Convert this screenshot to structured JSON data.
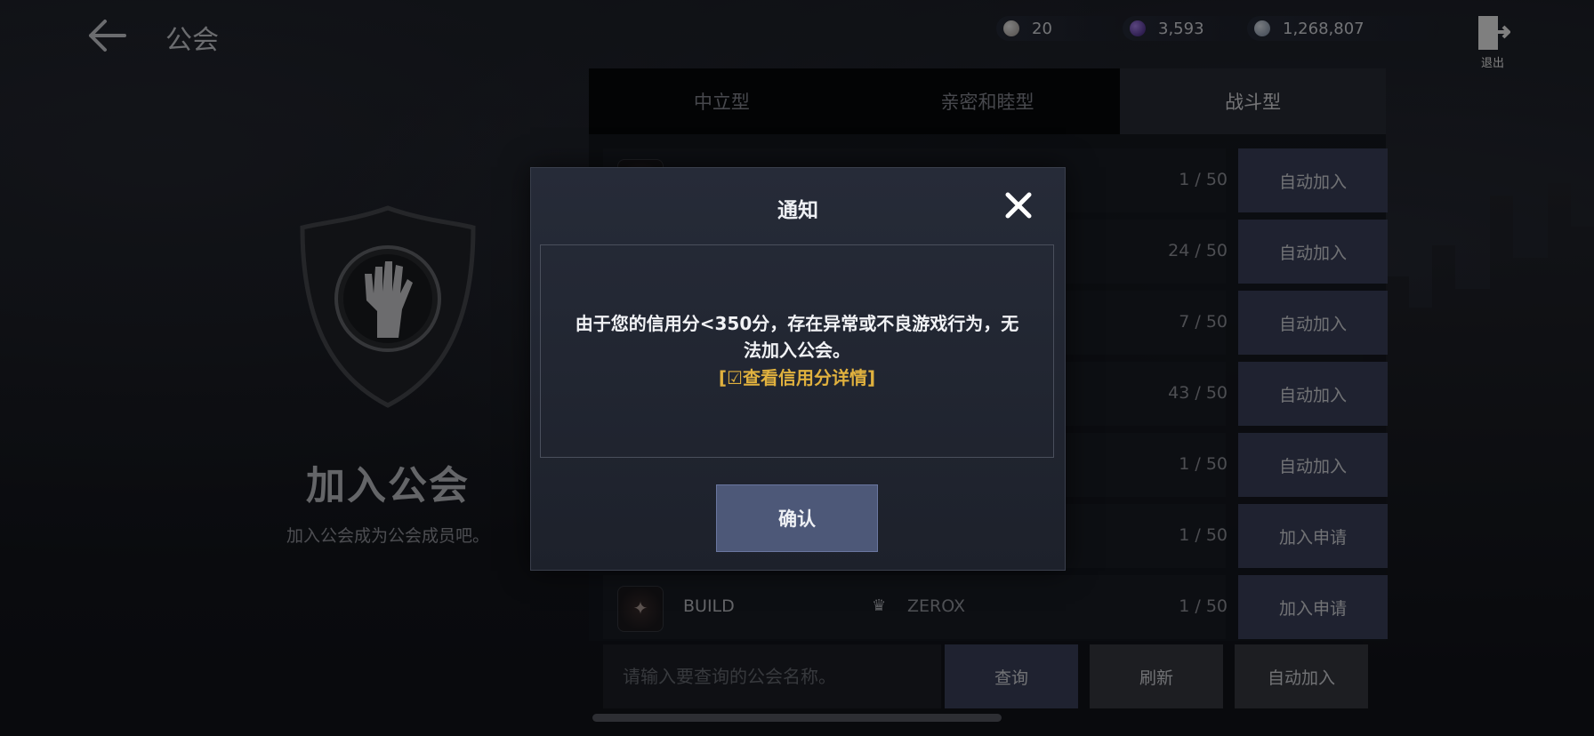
{
  "header": {
    "title": "公会",
    "currencies": [
      {
        "icon": "pearl-icon",
        "value": "20",
        "color": "#d9d4d0"
      },
      {
        "icon": "purple-gem-icon",
        "value": "3,593",
        "color": "#6b3fc4"
      },
      {
        "icon": "silver-coin-icon",
        "value": "1,268,807",
        "color": "#b9c7d8"
      }
    ],
    "exit_label": "退出"
  },
  "left_panel": {
    "title": "加入公会",
    "subtitle": "加入公会成为公会成员吧。"
  },
  "tabs": [
    {
      "label": "中立型",
      "active": false
    },
    {
      "label": "亲密和睦型",
      "active": false
    },
    {
      "label": "战斗型",
      "active": true
    }
  ],
  "guild_list": [
    {
      "name": "",
      "leader": "",
      "members": "1 / 50",
      "action": "自动加入"
    },
    {
      "name": "",
      "leader": "",
      "members": "24 / 50",
      "action": "自动加入"
    },
    {
      "name": "",
      "leader": "",
      "members": "7 / 50",
      "action": "自动加入"
    },
    {
      "name": "",
      "leader": "",
      "members": "43 / 50",
      "action": "自动加入"
    },
    {
      "name": "",
      "leader": "",
      "members": "1 / 50",
      "action": "自动加入"
    },
    {
      "name": "",
      "leader": "",
      "members": "1 / 50",
      "action": "加入申请"
    },
    {
      "name": "BUILD",
      "leader": "ZEROX",
      "members": "1 / 50",
      "action": "加入申请"
    }
  ],
  "search": {
    "placeholder": "请输入要查询的公会名称。",
    "query_label": "查询",
    "refresh_label": "刷新",
    "auto_join_label": "自动加入"
  },
  "colors": {
    "accent_button": "#3e4560",
    "link_gold": "#e0b13e",
    "active_tab": "#2a2e38"
  },
  "dialog": {
    "title": "通知",
    "message": "由于您的信用分<350分，存在异常或不良游戏行为，无法加入公会。",
    "link": "[☑查看信用分详情]",
    "confirm_label": "确认"
  }
}
